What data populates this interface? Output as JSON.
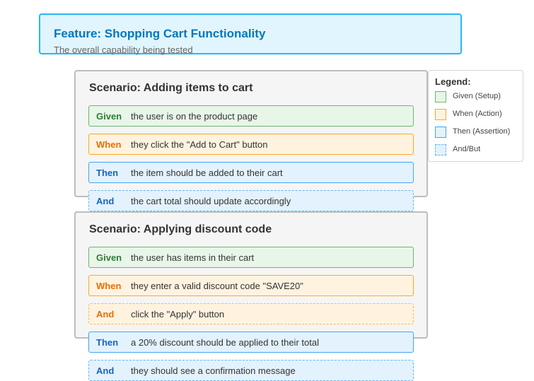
{
  "feature": {
    "title": "Feature: Shopping Cart Functionality",
    "subtitle": "The overall capability being tested"
  },
  "scenarios": [
    {
      "title": "Scenario: Adding items to cart",
      "steps": [
        {
          "keyword": "Given",
          "text": "the user is on the product page"
        },
        {
          "keyword": "When",
          "text": "they click the \"Add to Cart\" button"
        },
        {
          "keyword": "Then",
          "text": "the item should be added to their cart"
        },
        {
          "keyword": "And",
          "text": "the cart total should update accordingly"
        }
      ]
    },
    {
      "title": "Scenario: Applying discount code",
      "steps": [
        {
          "keyword": "Given",
          "text": "the user has items in their cart"
        },
        {
          "keyword": "When",
          "text": "they enter a valid discount code \"SAVE20\""
        },
        {
          "keyword": "And",
          "text": "click the \"Apply\" button"
        },
        {
          "keyword": "Then",
          "text": "a 20% discount should be applied to their total"
        },
        {
          "keyword": "And",
          "text": "they should see a confirmation message"
        }
      ]
    }
  ],
  "legend": {
    "title": "Legend:",
    "items": [
      {
        "label": "Given (Setup)",
        "fill": "#e8f5e9",
        "stroke": "#66bb6a"
      },
      {
        "label": "When (Action)",
        "fill": "#fff3e0",
        "stroke": "#ffa726"
      },
      {
        "label": "Then (Assertion)",
        "fill": "#e3f2fd",
        "stroke": "#42a5f5"
      },
      {
        "label": "And/But",
        "fill": "#e3f2fd",
        "stroke": "#64b5f6"
      }
    ]
  },
  "colors": {
    "feature_fill": "#e1f5fe",
    "feature_stroke": "#29b6f6",
    "feature_title": "#0277bd",
    "scenario_fill": "#f5f5f5",
    "scenario_stroke": "#bdbdbd",
    "given_keyword": "#2e7d32",
    "when_keyword": "#ef6c00",
    "then_keyword": "#1565c0"
  }
}
